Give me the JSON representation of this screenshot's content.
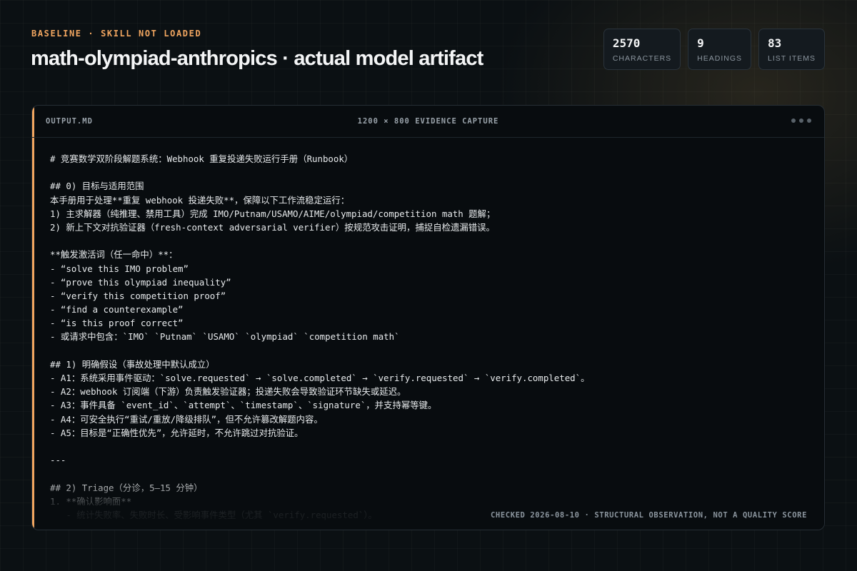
{
  "header": {
    "eyebrow": "BASELINE · SKILL NOT LOADED",
    "title": "math-olympiad-anthropics · actual model artifact"
  },
  "stats": [
    {
      "value": "2570",
      "label": "CHARACTERS"
    },
    {
      "value": "9",
      "label": "HEADINGS"
    },
    {
      "value": "83",
      "label": "LIST ITEMS"
    }
  ],
  "panel": {
    "file_name": "OUTPUT.MD",
    "capture_label": "1200 × 800 EVIDENCE CAPTURE",
    "footer_note": "CHECKED 2026-08-10 · STRUCTURAL OBSERVATION, NOT A QUALITY SCORE",
    "lines": [
      "# 竞赛数学双阶段解题系统：Webhook 重复投递失败运行手册（Runbook）",
      "",
      "## 0) 目标与适用范围",
      "本手册用于处理**重复 webhook 投递失败**，保障以下工作流稳定运行：",
      "1) 主求解器（纯推理、禁用工具）完成 IMO/Putnam/USAMO/AIME/olympiad/competition math 题解；",
      "2) 新上下文对抗验证器（fresh-context adversarial verifier）按规范攻击证明，捕捉自检遗漏错误。",
      "",
      "**触发激活词（任一命中）**：",
      "- “solve this IMO problem”",
      "- “prove this olympiad inequality”",
      "- “verify this competition proof”",
      "- “find a counterexample”",
      "- “is this proof correct”",
      "- 或请求中包含：`IMO` `Putnam` `USAMO` `olympiad` `competition math`",
      "",
      "## 1) 明确假设（事故处理中默认成立）",
      "- A1：系统采用事件驱动：`solve.requested` → `solve.completed` → `verify.requested` → `verify.completed`。",
      "- A2：webhook 订阅端（下游）负责触发验证器；投递失败会导致验证环节缺失或延迟。",
      "- A3：事件具备 `event_id`、`attempt`、`timestamp`、`signature`，并支持幂等键。",
      "- A4：可安全执行“重试/重放/降级排队”，但不允许篡改解题内容。",
      "- A5：目标是“正确性优先”，允许延时，不允许跳过对抗验证。",
      "",
      "---",
      "",
      "## 2) Triage（分诊，5–15 分钟）",
      "1. **确认影响面**",
      "   - 统计失败率、失败时长、受影响事件类型（尤其 `verify.requested`）。"
    ]
  }
}
